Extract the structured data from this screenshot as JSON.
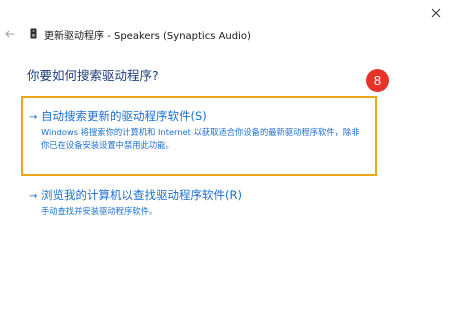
{
  "header": {
    "title": "更新驱动程序 - Speakers (Synaptics Audio)",
    "back_icon": "arrow-left-icon",
    "device_icon": "speaker-device-icon",
    "close_icon": "close-icon"
  },
  "main": {
    "question": "你要如何搜索驱动程序?",
    "options": [
      {
        "arrow": "→",
        "title": "自动搜索更新的驱动程序软件(S)",
        "description": "Windows 将搜索你的计算机和 Internet 以获取适合你设备的最新驱动程序软件，除非你已在设备安装设置中禁用此功能。"
      },
      {
        "arrow": "→",
        "title": "浏览我的计算机以查找驱动程序软件(R)",
        "description": "手动查找并安装驱动程序软件。"
      }
    ]
  },
  "annotation": {
    "step_number": "8",
    "badge_color": "#e8322a",
    "highlight_color": "#f0a31e"
  },
  "colors": {
    "link_blue": "#1a6fd0",
    "heading_navy": "#1e3f7d"
  }
}
